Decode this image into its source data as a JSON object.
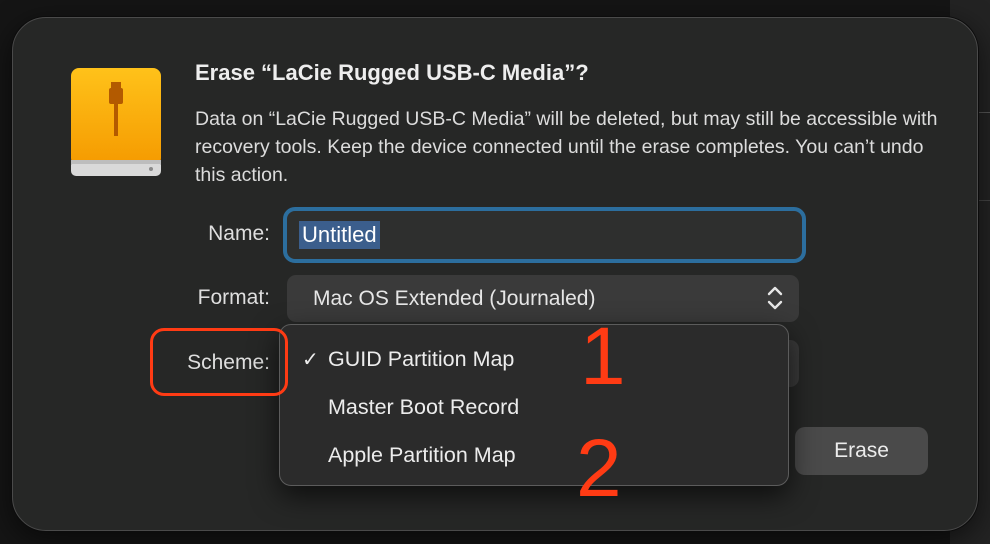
{
  "dialog": {
    "title": "Erase “LaCie Rugged USB-C Media”?",
    "message": "Data on “LaCie Rugged USB-C Media” will be deleted, but may still be accessible with recovery tools. Keep the device connected until the erase completes. You can’t undo this action.",
    "icon": "external-drive-icon"
  },
  "form": {
    "name_label": "Name:",
    "name_value": "Untitled",
    "format_label": "Format:",
    "format_value": "Mac OS Extended (Journaled)",
    "scheme_label": "Scheme:"
  },
  "scheme_menu": {
    "items": [
      {
        "label": "GUID Partition Map",
        "checked": true
      },
      {
        "label": "Master Boot Record",
        "checked": false
      },
      {
        "label": "Apple Partition Map",
        "checked": false
      }
    ],
    "check_glyph": "✓"
  },
  "buttons": {
    "erase_label": "Erase"
  },
  "annotations": {
    "number_1": "1",
    "number_2": "2",
    "color": "#ff3b14"
  },
  "colors": {
    "focus_ring": "#2c6e9e",
    "selection": "#3b5e8c",
    "drive_orange": "#f5a400"
  }
}
